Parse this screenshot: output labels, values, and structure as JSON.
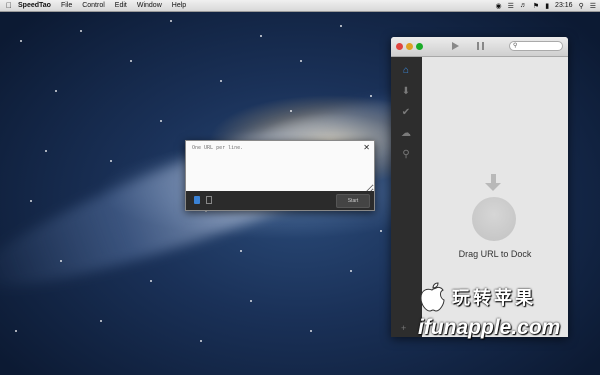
{
  "menubar": {
    "app_name": "SpeedTao",
    "menu_items": [
      "File",
      "Control",
      "Edit",
      "Window",
      "Help"
    ],
    "clock": "23:16",
    "status_icons": [
      "wifi-icon",
      "volume-icon",
      "flag-icon",
      "battery-icon",
      "search-icon",
      "list-icon"
    ]
  },
  "dialog": {
    "placeholder": "One URL per line.",
    "start_label": "Start"
  },
  "app_window": {
    "toolbar": {
      "play_icon": "play-icon",
      "pause_icon": "pause-icon",
      "search_placeholder": "Q"
    },
    "sidebar": [
      {
        "icon": "home-icon",
        "active": true
      },
      {
        "icon": "download-icon",
        "active": false
      },
      {
        "icon": "checkmark-icon",
        "active": false
      },
      {
        "icon": "cloud-icon",
        "active": false
      },
      {
        "icon": "search-icon",
        "active": false
      }
    ],
    "drop_label": "Drag URL to Dock"
  },
  "watermark": {
    "chinese": "玩转苹果",
    "url": "ifunapple.com"
  },
  "colors": {
    "accent": "#3c8be0",
    "sidebar_bg": "#2d2d2d"
  }
}
